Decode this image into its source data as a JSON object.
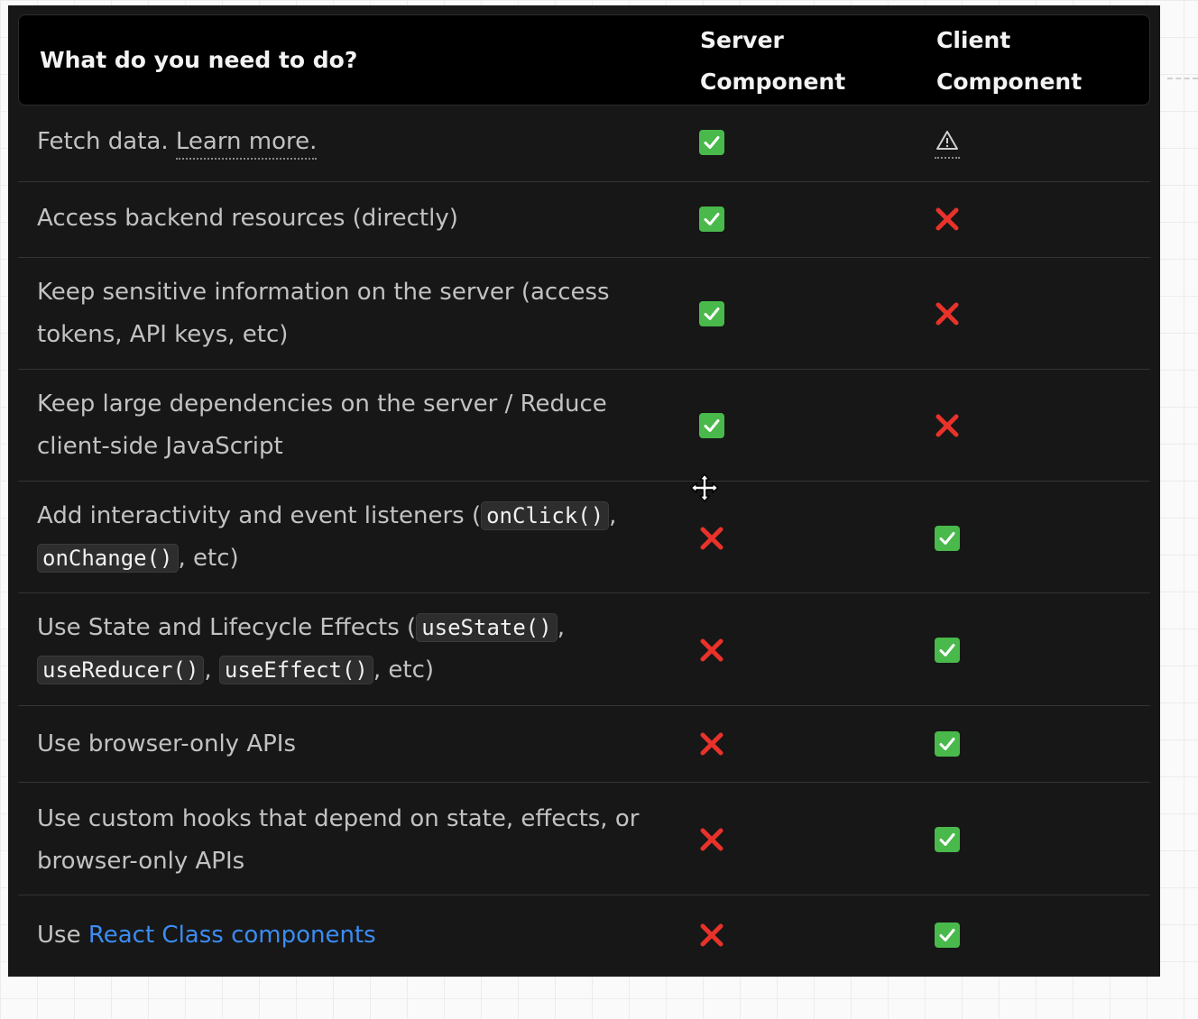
{
  "header": {
    "task_label": "What do you need to do?",
    "server_label": "Server\nComponent",
    "client_label": "Client\nComponent"
  },
  "rows": [
    {
      "text": "Fetch data. ",
      "link": "Learn more.",
      "server": "check",
      "client": "warn"
    },
    {
      "text": "Access backend resources (directly)",
      "server": "check",
      "client": "cross"
    },
    {
      "text": "Keep sensitive information on the server (access tokens, API keys, etc)",
      "server": "check",
      "client": "cross"
    },
    {
      "text": "Keep large dependencies on the server / Reduce client-side JavaScript",
      "server": "check",
      "client": "cross"
    },
    {
      "text_a": "Add interactivity and event listeners (",
      "code_a": "onClick()",
      "text_b": ", ",
      "code_b": "onChange()",
      "text_c": ", etc)",
      "server": "cross",
      "client": "check"
    },
    {
      "text_a": "Use State and Lifecycle Effects (",
      "code_a": "useState()",
      "text_b": ", ",
      "code_b": "useReducer()",
      "text_c": ", ",
      "code_c": "useEffect()",
      "text_d": ", etc)",
      "server": "cross",
      "client": "check"
    },
    {
      "text": "Use browser-only APIs",
      "server": "cross",
      "client": "check"
    },
    {
      "text": "Use custom hooks that depend on state, effects, or browser-only APIs",
      "server": "cross",
      "client": "check"
    },
    {
      "text": "Use ",
      "link": "React Class components",
      "server": "cross",
      "client": "check"
    }
  ],
  "icons": {
    "check": "check-icon",
    "cross": "cross-icon",
    "warn": "warning-icon",
    "cursor": "move-cursor-icon"
  },
  "colors": {
    "panel": "#171717",
    "header": "#000000",
    "text": "#c2c2c2",
    "link": "#3b8cf3",
    "check": "#49b94b",
    "cross": "#e8322a"
  }
}
